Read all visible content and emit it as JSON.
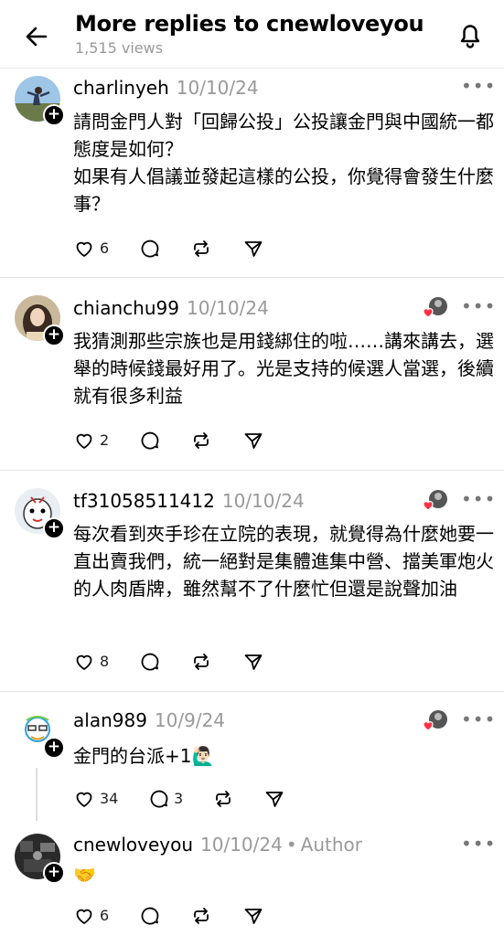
{
  "header": {
    "title": "More replies to cnewloveyou",
    "views": "1,515 views"
  },
  "posts": [
    {
      "username": "charlinyeh",
      "date": "10/10/24",
      "text": "請問金門人對「回歸公投」公投讓金門與中國統一都態度是如何？\n如果有人倡議並發起這樣的公投，你覺得會發生什麼事？",
      "likes": "6",
      "replies": ""
    },
    {
      "username": "chianchu99",
      "date": "10/10/24",
      "text": "我猜測那些宗族也是用錢綁住的啦……講來講去，選舉的時候錢最好用了。光是支持的候選人當選，後續就有很多利益",
      "likes": "2",
      "replies": ""
    },
    {
      "username": "tf31058511412",
      "date": "10/10/24",
      "text": "每次看到夾手珍在立院的表現，就覺得為什麼她要一直出賣我們，統一絕對是集體進集中營、擋美軍炮火的人肉盾牌，雖然幫不了什麼忙但還是說聲加油",
      "likes": "8",
      "replies": ""
    },
    {
      "username": "alan989",
      "date": "10/9/24",
      "text": "金門的台派+1🙋🏻‍♂️",
      "likes": "34",
      "replies": "3"
    },
    {
      "username": "cnewloveyou",
      "date": "10/10/24",
      "author_tag": "Author",
      "text": "🤝",
      "likes": "6",
      "replies": ""
    }
  ],
  "icons": {
    "back": "arrow-left-icon",
    "bell": "bell-icon",
    "like": "heart-icon",
    "reply": "comment-icon",
    "repost": "repost-icon",
    "share": "send-icon",
    "more": "more-icon"
  },
  "colors": {
    "muted": "#999999",
    "like_heart": "#ff3040"
  }
}
